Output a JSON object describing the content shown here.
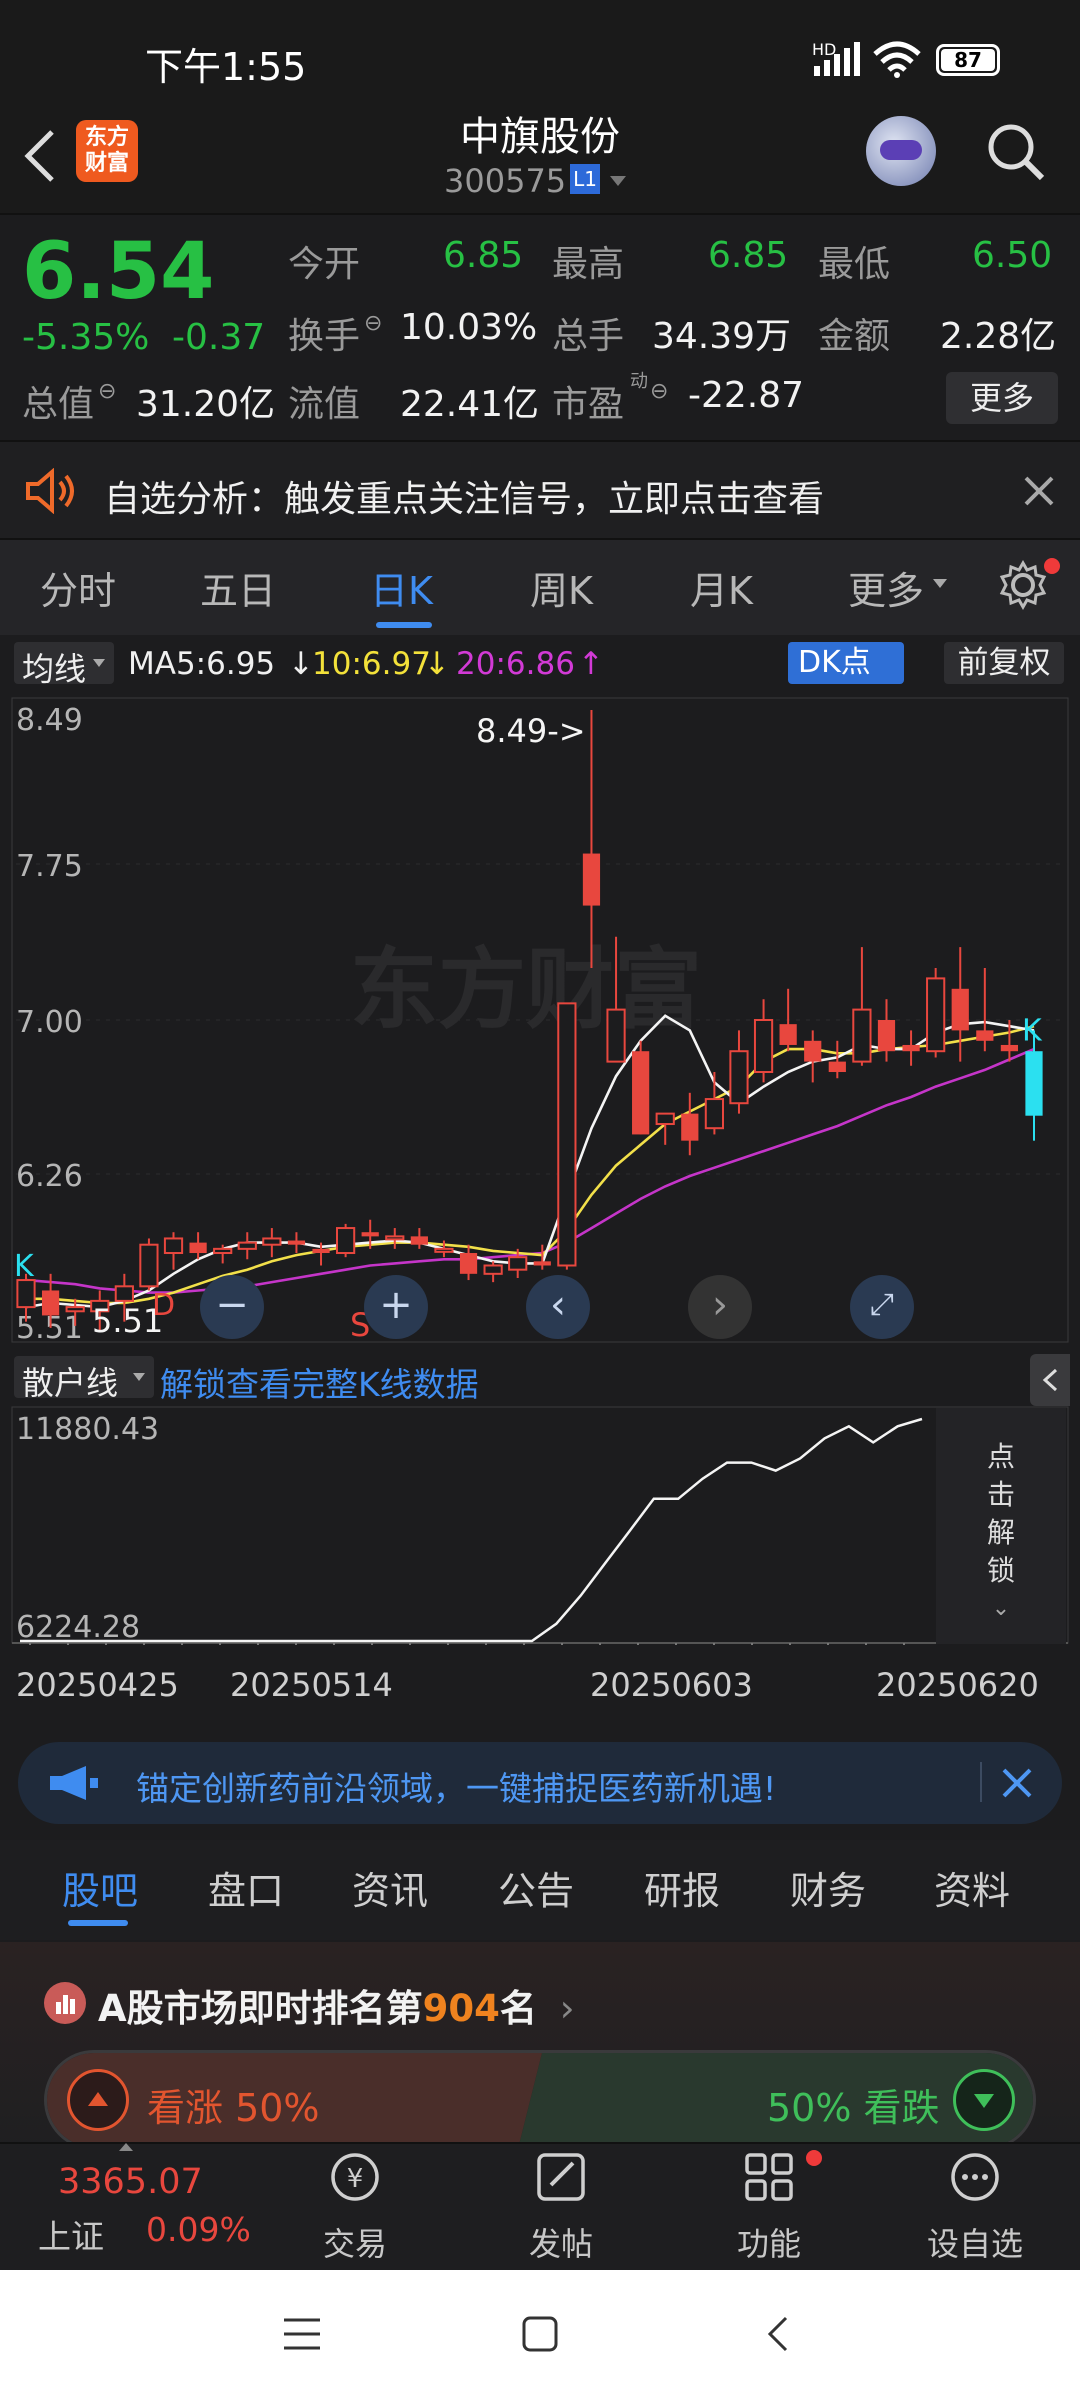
{
  "status_bar": {
    "time": "下午1:55",
    "battery": "87",
    "net": "HD"
  },
  "header": {
    "logo_line1": "东方",
    "logo_line2": "财富",
    "name": "中旗股份",
    "code": "300575",
    "level": "L1"
  },
  "quote": {
    "price": "6.54",
    "change_pct": "-5.35%",
    "change": "-0.37",
    "open_label": "今开",
    "open": "6.85",
    "high_label": "最高",
    "high": "6.85",
    "low_label": "最低",
    "low": "6.50",
    "turnover_label": "换手",
    "turnover": "10.03%",
    "volume_label": "总手",
    "volume": "34.39万",
    "amount_label": "金额",
    "amount": "2.28亿",
    "mcap_label": "总值",
    "mcap": "31.20亿",
    "float_label": "流值",
    "float": "22.41亿",
    "pe_label": "市盈",
    "pe_sup": "动",
    "pe": "-22.87",
    "more": "更多"
  },
  "notice": {
    "text": "自选分析：触发重点关注信号，立即点击查看"
  },
  "k_tabs": [
    "分时",
    "五日",
    "日K",
    "周K",
    "月K",
    "更多"
  ],
  "k_active": 2,
  "ma": {
    "selector": "均线",
    "ma5": "MA5:6.95",
    "ma10": "10:6.97",
    "ma20": "20:6.86",
    "dk": "DK点",
    "adjust": "前复权"
  },
  "chart_data": {
    "type": "candlestick",
    "y_ticks": [
      "8.49",
      "7.75",
      "7.00",
      "6.26",
      "5.51"
    ],
    "ylim": [
      5.51,
      8.49
    ],
    "annotations": [
      "8.49->",
      "5.51",
      "K",
      "D",
      "S"
    ],
    "x_ticks": [
      "20250425",
      "20250514",
      "20250603",
      "20250620"
    ],
    "candles": [
      {
        "o": 5.62,
        "h": 5.78,
        "l": 5.55,
        "c": 5.75
      },
      {
        "o": 5.7,
        "h": 5.78,
        "l": 5.52,
        "c": 5.58
      },
      {
        "o": 5.6,
        "h": 5.66,
        "l": 5.53,
        "c": 5.62
      },
      {
        "o": 5.6,
        "h": 5.7,
        "l": 5.51,
        "c": 5.65
      },
      {
        "o": 5.65,
        "h": 5.78,
        "l": 5.55,
        "c": 5.72
      },
      {
        "o": 5.72,
        "h": 5.95,
        "l": 5.7,
        "c": 5.92
      },
      {
        "o": 5.88,
        "h": 5.98,
        "l": 5.8,
        "c": 5.95
      },
      {
        "o": 5.93,
        "h": 5.98,
        "l": 5.85,
        "c": 5.88
      },
      {
        "o": 5.88,
        "h": 5.92,
        "l": 5.83,
        "c": 5.9
      },
      {
        "o": 5.9,
        "h": 5.98,
        "l": 5.85,
        "c": 5.93
      },
      {
        "o": 5.92,
        "h": 6.0,
        "l": 5.86,
        "c": 5.95
      },
      {
        "o": 5.94,
        "h": 5.98,
        "l": 5.88,
        "c": 5.92
      },
      {
        "o": 5.9,
        "h": 5.93,
        "l": 5.82,
        "c": 5.88
      },
      {
        "o": 5.88,
        "h": 6.02,
        "l": 5.86,
        "c": 6.0
      },
      {
        "o": 5.98,
        "h": 6.04,
        "l": 5.9,
        "c": 5.96
      },
      {
        "o": 5.95,
        "h": 6.0,
        "l": 5.9,
        "c": 5.96
      },
      {
        "o": 5.96,
        "h": 6.0,
        "l": 5.9,
        "c": 5.92
      },
      {
        "o": 5.9,
        "h": 5.94,
        "l": 5.86,
        "c": 5.9
      },
      {
        "o": 5.88,
        "h": 5.92,
        "l": 5.75,
        "c": 5.78
      },
      {
        "o": 5.78,
        "h": 5.84,
        "l": 5.74,
        "c": 5.82
      },
      {
        "o": 5.8,
        "h": 5.9,
        "l": 5.76,
        "c": 5.86
      },
      {
        "o": 5.84,
        "h": 5.92,
        "l": 5.8,
        "c": 5.82
      },
      {
        "o": 5.82,
        "h": 7.08,
        "l": 5.8,
        "c": 7.08
      },
      {
        "o": 7.8,
        "h": 8.49,
        "l": 7.25,
        "c": 7.55
      },
      {
        "o": 6.8,
        "h": 7.4,
        "l": 6.8,
        "c": 7.05
      },
      {
        "o": 6.85,
        "h": 6.9,
        "l": 6.45,
        "c": 6.45
      },
      {
        "o": 6.5,
        "h": 6.52,
        "l": 6.4,
        "c": 6.55
      },
      {
        "o": 6.55,
        "h": 6.65,
        "l": 6.35,
        "c": 6.42
      },
      {
        "o": 6.48,
        "h": 6.75,
        "l": 6.45,
        "c": 6.62
      },
      {
        "o": 6.6,
        "h": 6.95,
        "l": 6.55,
        "c": 6.85
      },
      {
        "o": 6.75,
        "h": 7.1,
        "l": 6.7,
        "c": 7.0
      },
      {
        "o": 6.98,
        "h": 7.15,
        "l": 6.85,
        "c": 6.88
      },
      {
        "o": 6.9,
        "h": 6.95,
        "l": 6.7,
        "c": 6.8
      },
      {
        "o": 6.8,
        "h": 6.9,
        "l": 6.72,
        "c": 6.75
      },
      {
        "o": 6.8,
        "h": 7.35,
        "l": 6.78,
        "c": 7.05
      },
      {
        "o": 7.0,
        "h": 7.1,
        "l": 6.8,
        "c": 6.85
      },
      {
        "o": 6.88,
        "h": 6.95,
        "l": 6.78,
        "c": 6.85
      },
      {
        "o": 6.85,
        "h": 7.25,
        "l": 6.82,
        "c": 7.2
      },
      {
        "o": 7.15,
        "h": 7.35,
        "l": 6.8,
        "c": 6.95
      },
      {
        "o": 6.95,
        "h": 7.25,
        "l": 6.85,
        "c": 6.9
      },
      {
        "o": 6.88,
        "h": 7.0,
        "l": 6.8,
        "c": 6.85
      },
      {
        "o": 6.85,
        "h": 6.95,
        "l": 6.42,
        "c": 6.54
      }
    ],
    "ma5": [
      5.62,
      5.64,
      5.63,
      5.62,
      5.65,
      5.7,
      5.78,
      5.85,
      5.9,
      5.93,
      5.93,
      5.93,
      5.91,
      5.92,
      5.93,
      5.94,
      5.93,
      5.9,
      5.87,
      5.84,
      5.83,
      5.83,
      6.16,
      6.48,
      6.73,
      6.9,
      7.02,
      6.95,
      6.7,
      6.6,
      6.68,
      6.75,
      6.8,
      6.82,
      6.88,
      6.86,
      6.86,
      6.94,
      6.98,
      6.99,
      6.97,
      6.95
    ],
    "ma10": [
      5.66,
      5.66,
      5.65,
      5.64,
      5.64,
      5.66,
      5.69,
      5.73,
      5.77,
      5.8,
      5.84,
      5.87,
      5.89,
      5.91,
      5.92,
      5.93,
      5.93,
      5.92,
      5.91,
      5.89,
      5.88,
      5.87,
      5.99,
      6.16,
      6.3,
      6.4,
      6.5,
      6.56,
      6.62,
      6.68,
      6.8,
      6.86,
      6.86,
      6.84,
      6.84,
      6.86,
      6.87,
      6.88,
      6.9,
      6.92,
      6.94,
      6.97
    ],
    "ma20": [
      5.75,
      5.74,
      5.73,
      5.71,
      5.7,
      5.69,
      5.69,
      5.7,
      5.71,
      5.72,
      5.74,
      5.76,
      5.78,
      5.8,
      5.82,
      5.83,
      5.84,
      5.85,
      5.85,
      5.86,
      5.87,
      5.88,
      5.93,
      6.0,
      6.07,
      6.14,
      6.2,
      6.25,
      6.29,
      6.33,
      6.37,
      6.41,
      6.45,
      6.49,
      6.54,
      6.59,
      6.63,
      6.68,
      6.72,
      6.76,
      6.81,
      6.86
    ],
    "sub_indicator": "散户线",
    "sub_ylim": [
      6224.28,
      11880.43
    ],
    "sub_line": [
      6330,
      6320,
      6310,
      6300,
      6300,
      6300,
      6300,
      6300,
      6300,
      6305,
      6300,
      6310,
      6320,
      6224,
      6230,
      6260,
      6290,
      6300,
      6330,
      6340,
      6340,
      6350,
      6800,
      7500,
      8300,
      9100,
      9900,
      9900,
      10400,
      10800,
      10800,
      10600,
      10900,
      11400,
      11700,
      11300,
      11700,
      11880
    ]
  },
  "sub_panel": {
    "selector": "散户线",
    "unlock_link": "解锁查看完整K线数据",
    "y_top": "11880.43",
    "y_bottom": "6224.28",
    "unlock_side": [
      "点",
      "击",
      "解",
      "锁"
    ]
  },
  "banner": {
    "text": "锚定创新药前沿领域，一键捕捉医药新机遇!"
  },
  "bottom_tabs": [
    "股吧",
    "盘口",
    "资讯",
    "公告",
    "研报",
    "财务",
    "资料"
  ],
  "bottom_active": 0,
  "rank": {
    "prefix": "A股市场即时排名第",
    "num": "904",
    "suffix": "名"
  },
  "vote": {
    "up": "看涨 50%",
    "down": "50% 看跌"
  },
  "bottom_nav": {
    "index_value": "3365.07",
    "index_name": "上证",
    "index_change": "0.09%",
    "items": [
      "交易",
      "发帖",
      "功能",
      "设自选"
    ]
  }
}
